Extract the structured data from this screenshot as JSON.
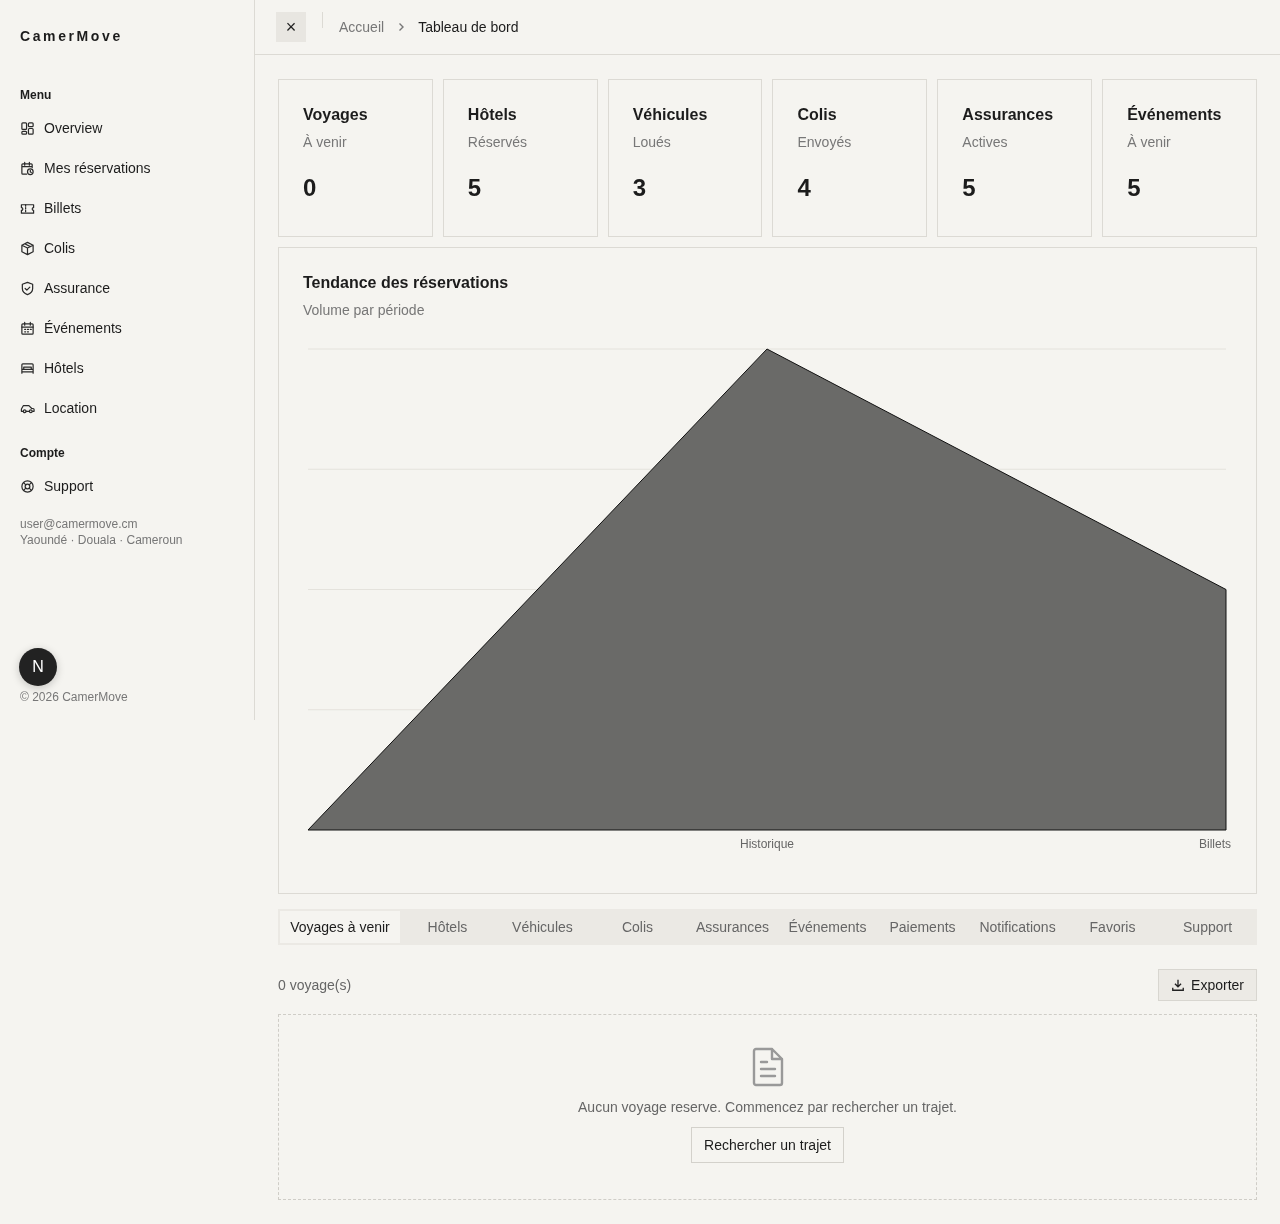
{
  "sidebar": {
    "brand": "CamerMove",
    "sections": [
      {
        "title": "Menu",
        "items": [
          {
            "label": "Overview",
            "kind": "grid"
          },
          {
            "label": "Mes réservations",
            "kind": "schedule"
          },
          {
            "label": "Billets",
            "kind": "ticket"
          },
          {
            "label": "Colis",
            "kind": "package"
          },
          {
            "label": "Assurance",
            "kind": "shield"
          },
          {
            "label": "Événements",
            "kind": "calendar"
          },
          {
            "label": "Hôtels",
            "kind": "bed"
          },
          {
            "label": "Location",
            "kind": "car"
          }
        ]
      },
      {
        "title": "Compte",
        "items": [
          {
            "label": "Support",
            "kind": "lifebuoy"
          }
        ]
      }
    ],
    "contact": [
      "user@camermove.cm",
      "Yaoundé · Douala · Cameroun"
    ],
    "badge": "N",
    "footer": "© 2026 CamerMove"
  },
  "header": {
    "close": "×",
    "breadcrumb": [
      "Accueil",
      "Tableau de bord"
    ]
  },
  "stats": [
    {
      "title": "Voyages",
      "subtitle": "À venir",
      "value": "0"
    },
    {
      "title": "Hôtels",
      "subtitle": "Réservés",
      "value": "5"
    },
    {
      "title": "Véhicules",
      "subtitle": "Loués",
      "value": "3"
    },
    {
      "title": "Colis",
      "subtitle": "Envoyés",
      "value": "4"
    },
    {
      "title": "Assurances",
      "subtitle": "Actives",
      "value": "5"
    },
    {
      "title": "Événements",
      "subtitle": "À venir",
      "value": "5"
    }
  ],
  "chart": {
    "title": "Tendance des réservations",
    "subtitle": "Volume par période",
    "x_labels": [
      "Historique",
      "Billets"
    ]
  },
  "tabs": [
    {
      "label": "Voyages à venir",
      "selected": true
    },
    {
      "label": "Hôtels",
      "selected": false
    },
    {
      "label": "Véhicules",
      "selected": false
    },
    {
      "label": "Colis",
      "selected": false
    },
    {
      "label": "Assurances",
      "selected": false
    },
    {
      "label": "Événements",
      "selected": false
    },
    {
      "label": "Paiements",
      "selected": false
    },
    {
      "label": "Notifications",
      "selected": false
    },
    {
      "label": "Favoris",
      "selected": false
    },
    {
      "label": "Support",
      "selected": false
    }
  ],
  "list": {
    "count": "0 voyage(s)",
    "export": "Exporter",
    "empty_message": "Aucun voyage reserve. Commencez par rechercher un trajet.",
    "action": "Rechercher un trajet"
  }
}
